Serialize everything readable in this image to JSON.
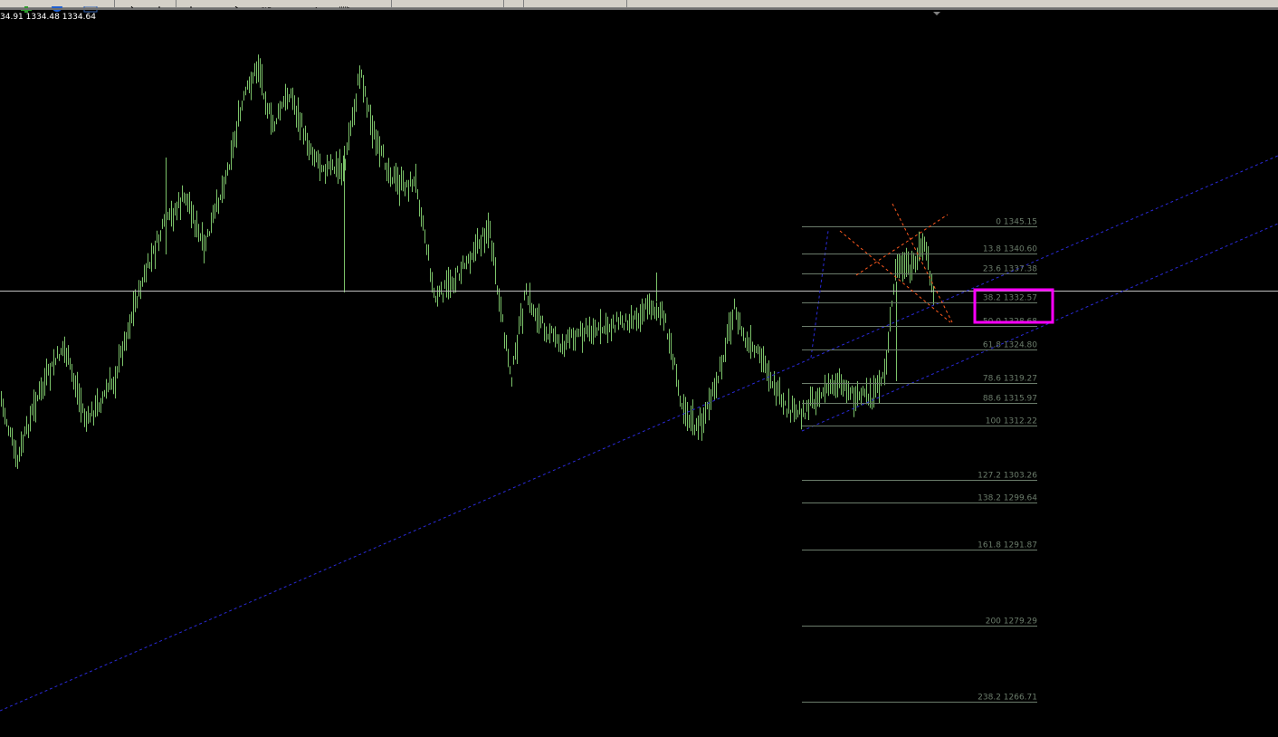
{
  "ohlc_readout": "34.91 1334.48 1334.64",
  "toolbar": {
    "buttons": [
      {
        "name": "new-order-button",
        "icon": "plus-icon"
      },
      {
        "name": "navigator-button",
        "icon": "globe-icon"
      },
      {
        "name": "terminal-button",
        "icon": "window-icon"
      },
      {
        "name": "cursor-tool",
        "icon": "cursor-icon"
      },
      {
        "name": "crosshair-tool",
        "icon": "crosshair-icon"
      },
      {
        "name": "vertical-line-tool",
        "icon": "vline-icon"
      },
      {
        "name": "trendline-tool",
        "icon": "trendline-icon"
      },
      {
        "name": "fibo-tool",
        "icon": "fibo-icon"
      },
      {
        "name": "text-tool",
        "icon": "text-icon"
      },
      {
        "name": "label-tool",
        "icon": "label-icon"
      },
      {
        "name": "arrows-tool",
        "icon": "arrow-icon"
      }
    ]
  },
  "colors": {
    "background": "#000000",
    "candles": "#7cc36a",
    "channel_line": "#2a2ad8",
    "fib_line": "#6b7c6b",
    "fib_text": "#6b7c6b",
    "fan_line": "#ff5a1f",
    "highlight_box": "#ff00ff",
    "price_line": "#c0c0c0"
  },
  "chart_data": {
    "type": "bar",
    "price_line_value": 1334.5,
    "highlight_level": "38.2",
    "fib_levels": [
      {
        "label": "0 1345.15",
        "price": 1345.15
      },
      {
        "label": "13.8 1340.60",
        "price": 1340.6
      },
      {
        "label": "23.6 1337.38",
        "price": 1337.38
      },
      {
        "label": "38.2 1332.57",
        "price": 1332.57
      },
      {
        "label": "50.0 1328.68",
        "price": 1328.68
      },
      {
        "label": "61.8 1324.80",
        "price": 1324.8
      },
      {
        "label": "78.6 1319.27",
        "price": 1319.27
      },
      {
        "label": "88.6 1315.97",
        "price": 1315.97
      },
      {
        "label": "100 1312.22",
        "price": 1312.22
      },
      {
        "label": "127.2 1303.26",
        "price": 1303.26
      },
      {
        "label": "138.2 1299.64",
        "price": 1299.64
      },
      {
        "label": "161.8 1291.87",
        "price": 1291.87
      },
      {
        "label": "200 1279.29",
        "price": 1279.29
      },
      {
        "label": "238.2 1266.71",
        "price": 1266.71
      }
    ]
  }
}
